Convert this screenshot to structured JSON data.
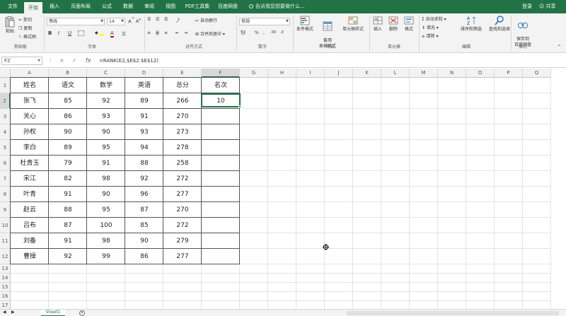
{
  "ribbon_tabs": [
    "文件",
    "开始",
    "插入",
    "页面布局",
    "公式",
    "数据",
    "审阅",
    "视图",
    "PDF工具集",
    "百度网盘"
  ],
  "active_tab": "开始",
  "tell_me": "告诉我您想要做什么...",
  "account": {
    "login": "登录",
    "share": "共享"
  },
  "clipboard": {
    "paste": "粘贴",
    "cut": "剪切",
    "copy": "复制",
    "format_painter": "格式刷",
    "label": "剪贴板"
  },
  "font": {
    "name": "等线",
    "size": "14",
    "bold": "B",
    "italic": "I",
    "underline": "U",
    "label": "字体"
  },
  "alignment": {
    "wrap": "自动换行",
    "merge": "合并后居中",
    "label": "对齐方式"
  },
  "number": {
    "format": "常规",
    "label": "数字"
  },
  "styles": {
    "conditional": "条件格式",
    "as_table": "套用\n表格格式",
    "cell_styles": "单元格样式",
    "label": "样式"
  },
  "cells": {
    "insert": "插入",
    "delete": "删除",
    "format": "格式",
    "label": "单元格"
  },
  "editing": {
    "autosum": "自动求和",
    "fill": "填充",
    "clear": "清除",
    "sort": "排序和筛选",
    "find": "查找和选择",
    "label": "编辑"
  },
  "save": {
    "save_to": "保存到\n百度网盘",
    "label": "保存"
  },
  "formula_bar": {
    "name_box": "F2",
    "cancel": "×",
    "enter": "✓",
    "fx": "fx",
    "formula": "=RANK(E2,$E$2:$E$12)"
  },
  "columns": [
    "A",
    "B",
    "C",
    "D",
    "E",
    "F",
    "G",
    "H",
    "I",
    "J",
    "K",
    "L",
    "M",
    "N",
    "O",
    "P",
    "Q"
  ],
  "rows": [
    "1",
    "2",
    "3",
    "4",
    "5",
    "6",
    "7",
    "8",
    "9",
    "10",
    "11",
    "12",
    "13",
    "14",
    "15",
    "16",
    "17"
  ],
  "selected_cell": "F2",
  "table": {
    "headers": [
      "姓名",
      "语文",
      "数学",
      "英语",
      "总分",
      "名次"
    ],
    "rows": [
      [
        "张飞",
        "85",
        "92",
        "89",
        "266",
        "10"
      ],
      [
        "关心",
        "86",
        "93",
        "91",
        "270",
        ""
      ],
      [
        "孙权",
        "90",
        "90",
        "93",
        "273",
        ""
      ],
      [
        "李白",
        "89",
        "95",
        "94",
        "278",
        ""
      ],
      [
        "杜青玉",
        "79",
        "91",
        "88",
        "258",
        ""
      ],
      [
        "宋江",
        "82",
        "98",
        "92",
        "272",
        ""
      ],
      [
        "叶青",
        "91",
        "90",
        "96",
        "277",
        ""
      ],
      [
        "赵云",
        "88",
        "95",
        "87",
        "270",
        ""
      ],
      [
        "吕布",
        "87",
        "100",
        "85",
        "272",
        ""
      ],
      [
        "刘备",
        "91",
        "98",
        "90",
        "279",
        ""
      ],
      [
        "曹操",
        "92",
        "99",
        "86",
        "277",
        ""
      ]
    ]
  },
  "sheet_tab": "Sheet1",
  "colors": {
    "accent": "#217346"
  }
}
